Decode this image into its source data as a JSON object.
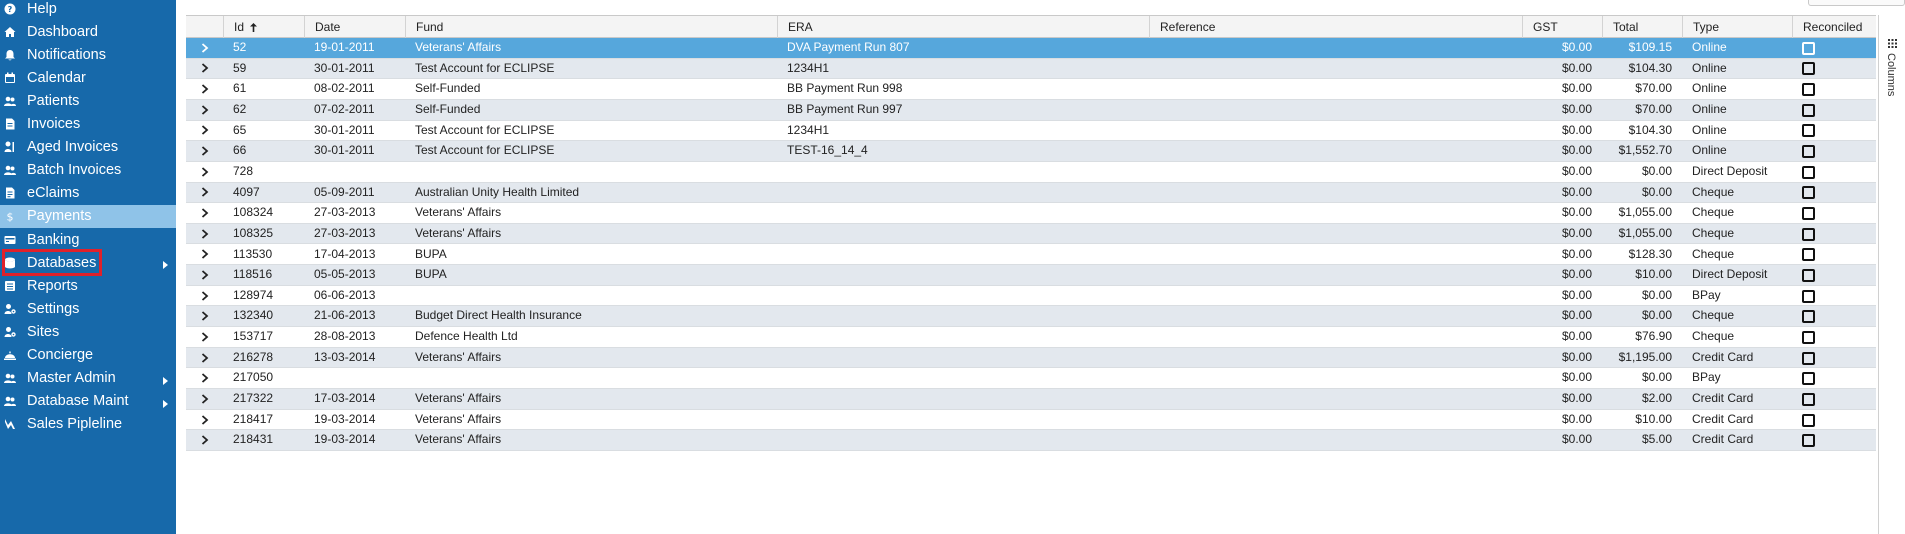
{
  "sidebar": {
    "items": [
      {
        "label": "Help",
        "icon": "help-icon"
      },
      {
        "label": "Dashboard",
        "icon": "home-icon"
      },
      {
        "label": "Notifications",
        "icon": "bell-icon"
      },
      {
        "label": "Calendar",
        "icon": "calendar-icon"
      },
      {
        "label": "Patients",
        "icon": "users-icon"
      },
      {
        "label": "Invoices",
        "icon": "invoice-icon"
      },
      {
        "label": "Aged Invoices",
        "icon": "aged-invoice-icon"
      },
      {
        "label": "Batch Invoices",
        "icon": "users-icon"
      },
      {
        "label": "eClaims",
        "icon": "document-icon"
      },
      {
        "label": "Payments",
        "icon": "dollar-icon",
        "active": true
      },
      {
        "label": "Banking",
        "icon": "banking-icon"
      },
      {
        "label": "Databases",
        "icon": "database-icon",
        "submenu": true
      },
      {
        "label": "Reports",
        "icon": "list-icon"
      },
      {
        "label": "Settings",
        "icon": "user-gear-icon"
      },
      {
        "label": "Sites",
        "icon": "user-gear-icon"
      },
      {
        "label": "Concierge",
        "icon": "concierge-icon"
      },
      {
        "label": "Master Admin",
        "icon": "users-icon",
        "submenu": true
      },
      {
        "label": "Database Maint",
        "icon": "users-icon",
        "submenu": true
      },
      {
        "label": "Sales Pipleline",
        "icon": "pipeline-icon"
      }
    ]
  },
  "grid": {
    "columns": [
      {
        "key": "id",
        "label": "Id",
        "sorted": "asc"
      },
      {
        "key": "date",
        "label": "Date"
      },
      {
        "key": "fund",
        "label": "Fund"
      },
      {
        "key": "era",
        "label": "ERA"
      },
      {
        "key": "reference",
        "label": "Reference"
      },
      {
        "key": "gst",
        "label": "GST"
      },
      {
        "key": "total",
        "label": "Total"
      },
      {
        "key": "type",
        "label": "Type"
      },
      {
        "key": "reconciled",
        "label": "Reconciled"
      }
    ],
    "rows": [
      {
        "id": "52",
        "date": "19-01-2011",
        "fund": "Veterans' Affairs",
        "era": "DVA Payment Run 807",
        "reference": "",
        "gst": "$0.00",
        "total": "$109.15",
        "type": "Online",
        "reconciled": false,
        "selected": true
      },
      {
        "id": "59",
        "date": "30-01-2011",
        "fund": "Test Account for ECLIPSE",
        "era": "1234H1",
        "reference": "",
        "gst": "$0.00",
        "total": "$104.30",
        "type": "Online",
        "reconciled": false
      },
      {
        "id": "61",
        "date": "08-02-2011",
        "fund": "Self-Funded",
        "era": "BB Payment Run 998",
        "reference": "",
        "gst": "$0.00",
        "total": "$70.00",
        "type": "Online",
        "reconciled": false
      },
      {
        "id": "62",
        "date": "07-02-2011",
        "fund": "Self-Funded",
        "era": "BB Payment Run 997",
        "reference": "",
        "gst": "$0.00",
        "total": "$70.00",
        "type": "Online",
        "reconciled": false
      },
      {
        "id": "65",
        "date": "30-01-2011",
        "fund": "Test Account for ECLIPSE",
        "era": "1234H1",
        "reference": "",
        "gst": "$0.00",
        "total": "$104.30",
        "type": "Online",
        "reconciled": false
      },
      {
        "id": "66",
        "date": "30-01-2011",
        "fund": "Test Account for ECLIPSE",
        "era": "TEST-16_14_4",
        "reference": "",
        "gst": "$0.00",
        "total": "$1,552.70",
        "type": "Online",
        "reconciled": false
      },
      {
        "id": "728",
        "date": "",
        "fund": "",
        "era": "",
        "reference": "",
        "gst": "$0.00",
        "total": "$0.00",
        "type": "Direct Deposit",
        "reconciled": false
      },
      {
        "id": "4097",
        "date": "05-09-2011",
        "fund": "Australian Unity Health Limited",
        "era": "",
        "reference": "",
        "gst": "$0.00",
        "total": "$0.00",
        "type": "Cheque",
        "reconciled": false
      },
      {
        "id": "108324",
        "date": "27-03-2013",
        "fund": "Veterans' Affairs",
        "era": "",
        "reference": "",
        "gst": "$0.00",
        "total": "$1,055.00",
        "type": "Cheque",
        "reconciled": false
      },
      {
        "id": "108325",
        "date": "27-03-2013",
        "fund": "Veterans' Affairs",
        "era": "",
        "reference": "",
        "gst": "$0.00",
        "total": "$1,055.00",
        "type": "Cheque",
        "reconciled": false
      },
      {
        "id": "113530",
        "date": "17-04-2013",
        "fund": "BUPA",
        "era": "",
        "reference": "",
        "gst": "$0.00",
        "total": "$128.30",
        "type": "Cheque",
        "reconciled": false
      },
      {
        "id": "118516",
        "date": "05-05-2013",
        "fund": "BUPA",
        "era": "",
        "reference": "",
        "gst": "$0.00",
        "total": "$10.00",
        "type": "Direct Deposit",
        "reconciled": false
      },
      {
        "id": "128974",
        "date": "06-06-2013",
        "fund": "",
        "era": "",
        "reference": "",
        "gst": "$0.00",
        "total": "$0.00",
        "type": "BPay",
        "reconciled": false
      },
      {
        "id": "132340",
        "date": "21-06-2013",
        "fund": "Budget Direct Health Insurance",
        "era": "",
        "reference": "",
        "gst": "$0.00",
        "total": "$0.00",
        "type": "Cheque",
        "reconciled": false
      },
      {
        "id": "153717",
        "date": "28-08-2013",
        "fund": "Defence Health Ltd",
        "era": "",
        "reference": "",
        "gst": "$0.00",
        "total": "$76.90",
        "type": "Cheque",
        "reconciled": false
      },
      {
        "id": "216278",
        "date": "13-03-2014",
        "fund": "Veterans' Affairs",
        "era": "",
        "reference": "",
        "gst": "$0.00",
        "total": "$1,195.00",
        "type": "Credit Card",
        "reconciled": false
      },
      {
        "id": "217050",
        "date": "",
        "fund": "",
        "era": "",
        "reference": "",
        "gst": "$0.00",
        "total": "$0.00",
        "type": "BPay",
        "reconciled": false
      },
      {
        "id": "217322",
        "date": "17-03-2014",
        "fund": "Veterans' Affairs",
        "era": "",
        "reference": "",
        "gst": "$0.00",
        "total": "$2.00",
        "type": "Credit Card",
        "reconciled": false
      },
      {
        "id": "218417",
        "date": "19-03-2014",
        "fund": "Veterans' Affairs",
        "era": "",
        "reference": "",
        "gst": "$0.00",
        "total": "$10.00",
        "type": "Credit Card",
        "reconciled": false
      },
      {
        "id": "218431",
        "date": "19-03-2014",
        "fund": "Veterans' Affairs",
        "era": "",
        "reference": "",
        "gst": "$0.00",
        "total": "$5.00",
        "type": "Credit Card",
        "reconciled": false
      }
    ]
  },
  "side_panel": {
    "columns_label": "Columns"
  },
  "colors": {
    "sidebar_bg": "#1769aa",
    "active_bg": "#8fc3e8",
    "selected_row": "#56a7dc",
    "alt_row": "#e3e8ee",
    "highlight_outline": "#e0212a"
  }
}
